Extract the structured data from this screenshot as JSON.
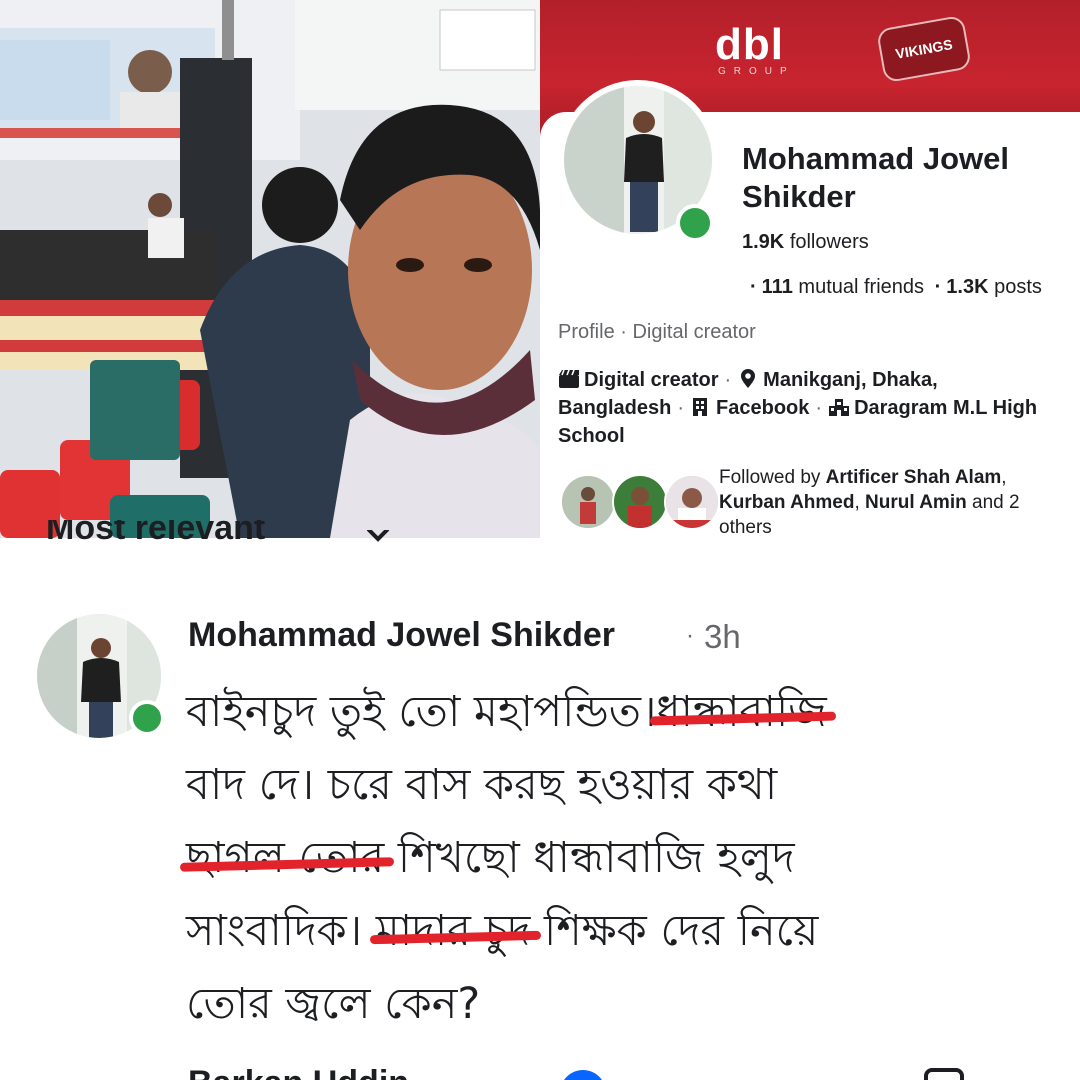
{
  "cover": {
    "logo": "dbl",
    "logo_sub": "GROUP",
    "badge": "VIKINGS"
  },
  "profile": {
    "name": "Mohammad Jowel Shikder",
    "followers_count": "1.9K",
    "followers_label": "followers",
    "mutual_count": "111",
    "mutual_label": "mutual friends",
    "posts_count": "1.3K",
    "posts_label": "posts",
    "profile_type": "Profile · Digital creator",
    "details": {
      "category": "Digital creator",
      "location": "Manikganj, Dhaka, Bangladesh",
      "work": "Facebook",
      "school": "Daragram M.L High School"
    },
    "followed_by_prefix": "Followed by",
    "followed_by": [
      "Artificer Shah Alam",
      "Kurban Ahmed",
      "Nurul Amin"
    ],
    "followed_by_others": "2 others",
    "colors": {
      "online": "#31a24c",
      "cover": "#c8242f"
    }
  },
  "comments": {
    "sort_label": "Most relevant",
    "comment": {
      "author": "Mohammad Jowel Shikder",
      "time": "3h",
      "lines": [
        {
          "a": "বাইনচুদ তুই তো মহাপন্ডিত।",
          "struck": "ধান্ধাবাজি",
          "b": ""
        },
        {
          "a": "বাদ দে। চরে বাস করছ হওয়ার কথা",
          "struck": "",
          "b": ""
        },
        {
          "a": "",
          "struck": "ছাগল তোর",
          "b": " শিখছো ধান্ধাবাজি হলুদ"
        },
        {
          "a": "সাংবাদিক। ",
          "struck": "মাদার চুদ",
          "b": " শিক্ষক দের নিয়ে"
        },
        {
          "a": "তোর জ্বলে কেন?",
          "struck": "",
          "b": ""
        }
      ],
      "strike_color": "#e3232c"
    },
    "reply_peek_name": "Barkan Uddin"
  }
}
